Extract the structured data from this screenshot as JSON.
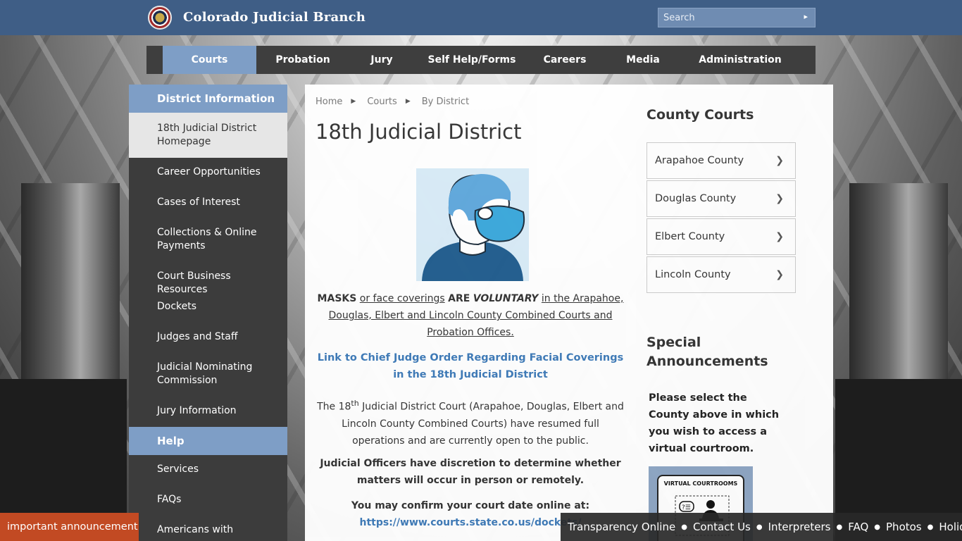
{
  "header": {
    "brand": "Colorado Judicial Branch",
    "search_placeholder": "Search",
    "search_go": "▸"
  },
  "nav": [
    {
      "label": "Courts",
      "active": true
    },
    {
      "label": "Probation",
      "active": false
    },
    {
      "label": "Jury",
      "active": false
    },
    {
      "label": "Self Help/Forms",
      "active": false
    },
    {
      "label": "Careers",
      "active": false
    },
    {
      "label": "Media",
      "active": false
    },
    {
      "label": "Administration",
      "active": false
    }
  ],
  "sidebar": {
    "section1": "District Information",
    "items": [
      "18th Judicial District Homepage",
      "Career Opportunities",
      "Cases of Interest",
      "Collections & Online Payments",
      "Court Business Resources",
      "Dockets",
      "Judges and Staff",
      "Judicial Nominating Commission",
      "Jury Information"
    ],
    "section2": "Help",
    "help_items": [
      "Services",
      "FAQs",
      "Americans with"
    ]
  },
  "content": {
    "breadcrumb": [
      "Home",
      "Courts",
      "By District"
    ],
    "title": "18th Judicial District",
    "mask_masks": "MASKS",
    "mask_or": "or face coverings",
    "mask_are": "ARE",
    "mask_voluntary": "VOLUNTARY",
    "mask_rest": "in the Arapahoe, Douglas, Elbert and Lincoln County Combined Courts and Probation Offices.",
    "order_link": "Link to Chief Judge Order Regarding Facial Coverings in the 18th Judicial District",
    "ops_pre": "The 18",
    "ops_sup": "th",
    "ops_post": " Judicial District Court (Arapahoe, Douglas, Elbert and Lincoln County Combined Courts) have resumed full operations and are currently open to the public.",
    "officers": "Judicial Officers have discretion to determine whether matters will occur in person or remotely.",
    "confirm_text": "You may confirm your court date online at: ",
    "confirm_link": "https://www.courts.state.co.us/dockets/"
  },
  "right": {
    "county_title": "County Courts",
    "counties": [
      "Arapahoe County",
      "Douglas County",
      "Elbert County",
      "Lincoln County"
    ],
    "special_title": "Special Announcements",
    "special_text": "Please select the County above in which you wish to access a virtual courtroom.",
    "vc_label": "VIRTUAL COURTROOMS"
  },
  "footer": {
    "announcement": "important announcement",
    "links": [
      "Transparency Online",
      "Contact Us",
      "Interpreters",
      "FAQ",
      "Photos",
      "Holidays"
    ]
  },
  "colors": {
    "header_blue": "#3f5e86",
    "accent_blue": "#7e9ec6",
    "nav_dark": "#3e3e3e",
    "link_blue": "#3d7ab8",
    "announce_orange": "#c24a23"
  }
}
